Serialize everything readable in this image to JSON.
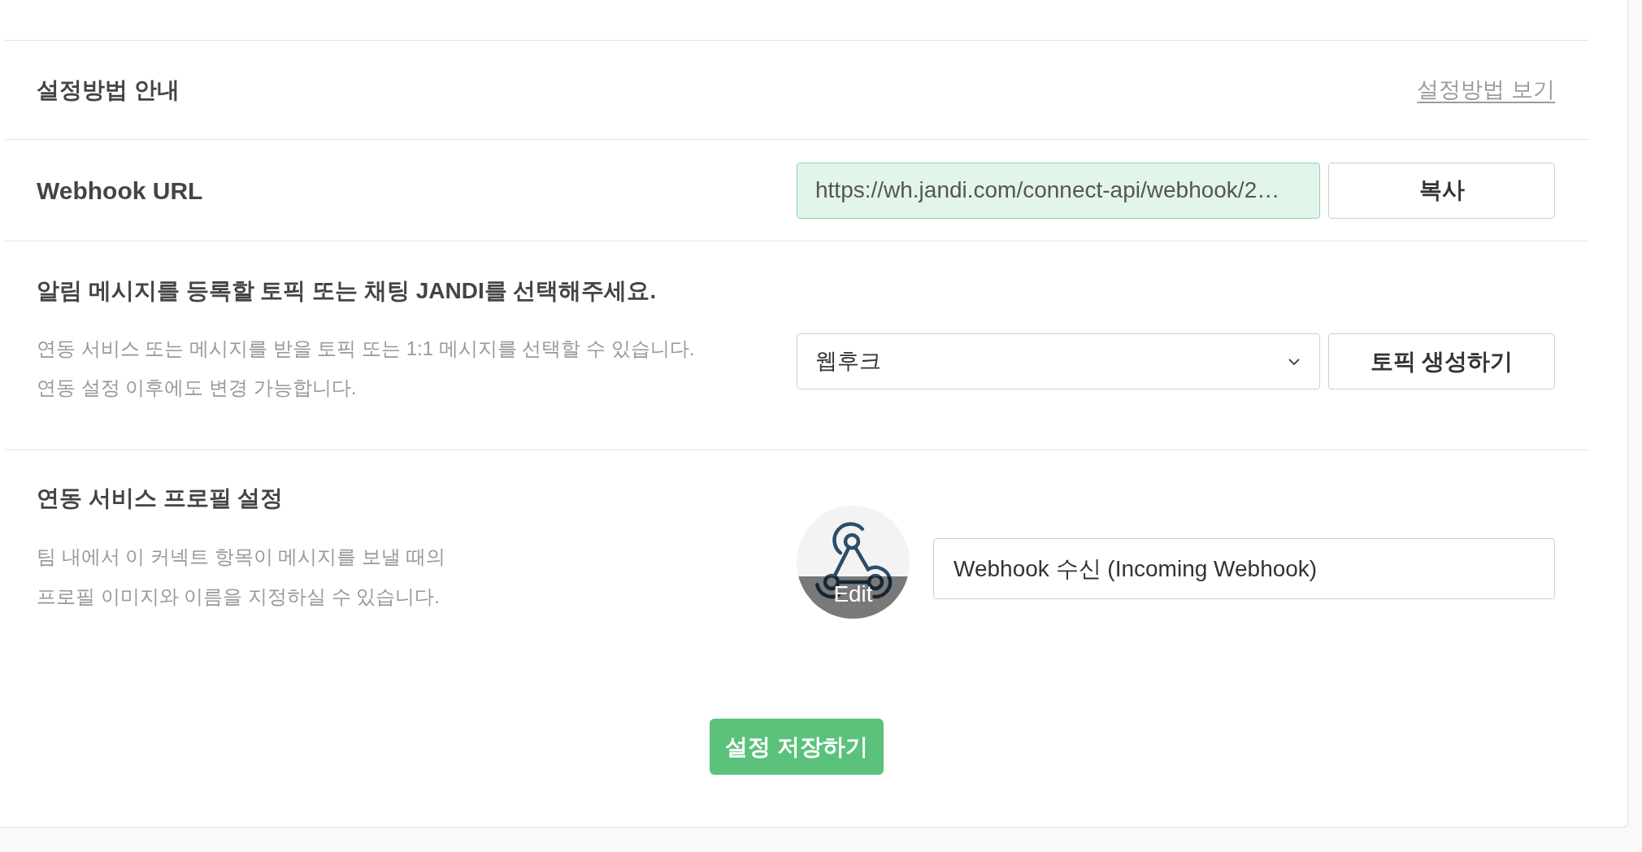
{
  "guide": {
    "title": "설정방법 안내",
    "link": "설정방법 보기"
  },
  "webhook_url": {
    "label": "Webhook URL",
    "value": "https://wh.jandi.com/connect-api/webhook/2…",
    "copy_button": "복사"
  },
  "topic": {
    "title": "알림 메시지를 등록할 토픽 또는 채팅 JANDI를 선택해주세요.",
    "description": [
      "연동 서비스 또는 메시지를 받을 토픽 또는 1:1 메시지를 선택할 수 있습니다.",
      "연동 설정 이후에도 변경 가능합니다."
    ],
    "select": {
      "value": "웹후크"
    },
    "create_button": "토픽 생성하기"
  },
  "profile": {
    "title": "연동 서비스 프로필 설정",
    "description": [
      "팀 내에서 이 커넥트 항목이 메시지를 보낼 때의",
      "프로필 이미지와 이름을 지정하실 수 있습니다."
    ],
    "avatar": {
      "edit_label": "Edit"
    },
    "name_field": {
      "value": "Webhook 수신 (Incoming Webhook)"
    }
  },
  "save_button": "설정 저장하기"
}
